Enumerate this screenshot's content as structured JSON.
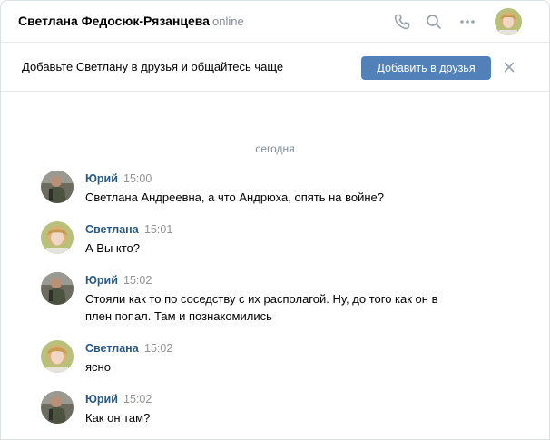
{
  "header": {
    "name": "Светлана Федосюк-Рязанцева",
    "status": "online",
    "icons": [
      "phone-icon",
      "search-icon",
      "more-icon"
    ]
  },
  "banner": {
    "text": "Добавьте Светлану в друзья и общайтесь чаще",
    "button_label": "Добавить в друзья"
  },
  "date_separator": "сегодня",
  "messages": [
    {
      "author": "Юрий",
      "time": "15:00",
      "text": "Светлана Андреевна, а что Андрюха, опять на войне?"
    },
    {
      "author": "Светлана",
      "time": "15:01",
      "text": "А Вы кто?"
    },
    {
      "author": "Юрий",
      "time": "15:02",
      "text": "Стояли как то по соседству с их располагой. Ну, до того как он в плен попал. Там и познакомились"
    },
    {
      "author": "Светлана",
      "time": "15:02",
      "text": "ясно"
    },
    {
      "author": "Юрий",
      "time": "15:02",
      "text": "Как он там?"
    }
  ],
  "colors": {
    "accent": "#5181b8",
    "author_link": "#2a5885",
    "muted": "#818c99",
    "divider": "#e7e8ec"
  }
}
